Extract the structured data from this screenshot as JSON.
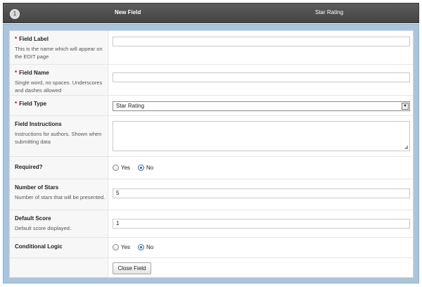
{
  "header": {
    "order": "1",
    "label": "New Field",
    "type": "Star Rating"
  },
  "fields": {
    "field_label": {
      "label": "Field Label",
      "required_marker": "*",
      "description": "This is the name which will appear on the EDIT page",
      "value": ""
    },
    "field_name": {
      "label": "Field Name",
      "required_marker": "*",
      "description": "Single word, no spaces. Underscores and dashes allowed",
      "value": ""
    },
    "field_type": {
      "label": "Field Type",
      "required_marker": "*",
      "selected": "Star Rating"
    },
    "field_instructions": {
      "label": "Field Instructions",
      "description": "Instructions for authors. Shown when submitting data",
      "value": ""
    },
    "required": {
      "label": "Required?",
      "options": [
        "Yes",
        "No"
      ],
      "selected": "No"
    },
    "number_of_stars": {
      "label": "Number of Stars",
      "description": "Number of stars that will be presented.",
      "value": "5"
    },
    "default_score": {
      "label": "Default Score",
      "description": "Default score displayed.",
      "value": "1"
    },
    "conditional_logic": {
      "label": "Conditional Logic",
      "options": [
        "Yes",
        "No"
      ],
      "selected": "No"
    }
  },
  "actions": {
    "close_label": "Close Field"
  },
  "colors": {
    "header_bg": "#4f4f4f",
    "panel_border": "#a9c5dd",
    "required_marker": "#cc0000",
    "radio_checked": "#2a5fae"
  },
  "icons": {
    "select_arrow": "chevron-down-icon",
    "textarea_resize": "resize-grip-icon"
  }
}
